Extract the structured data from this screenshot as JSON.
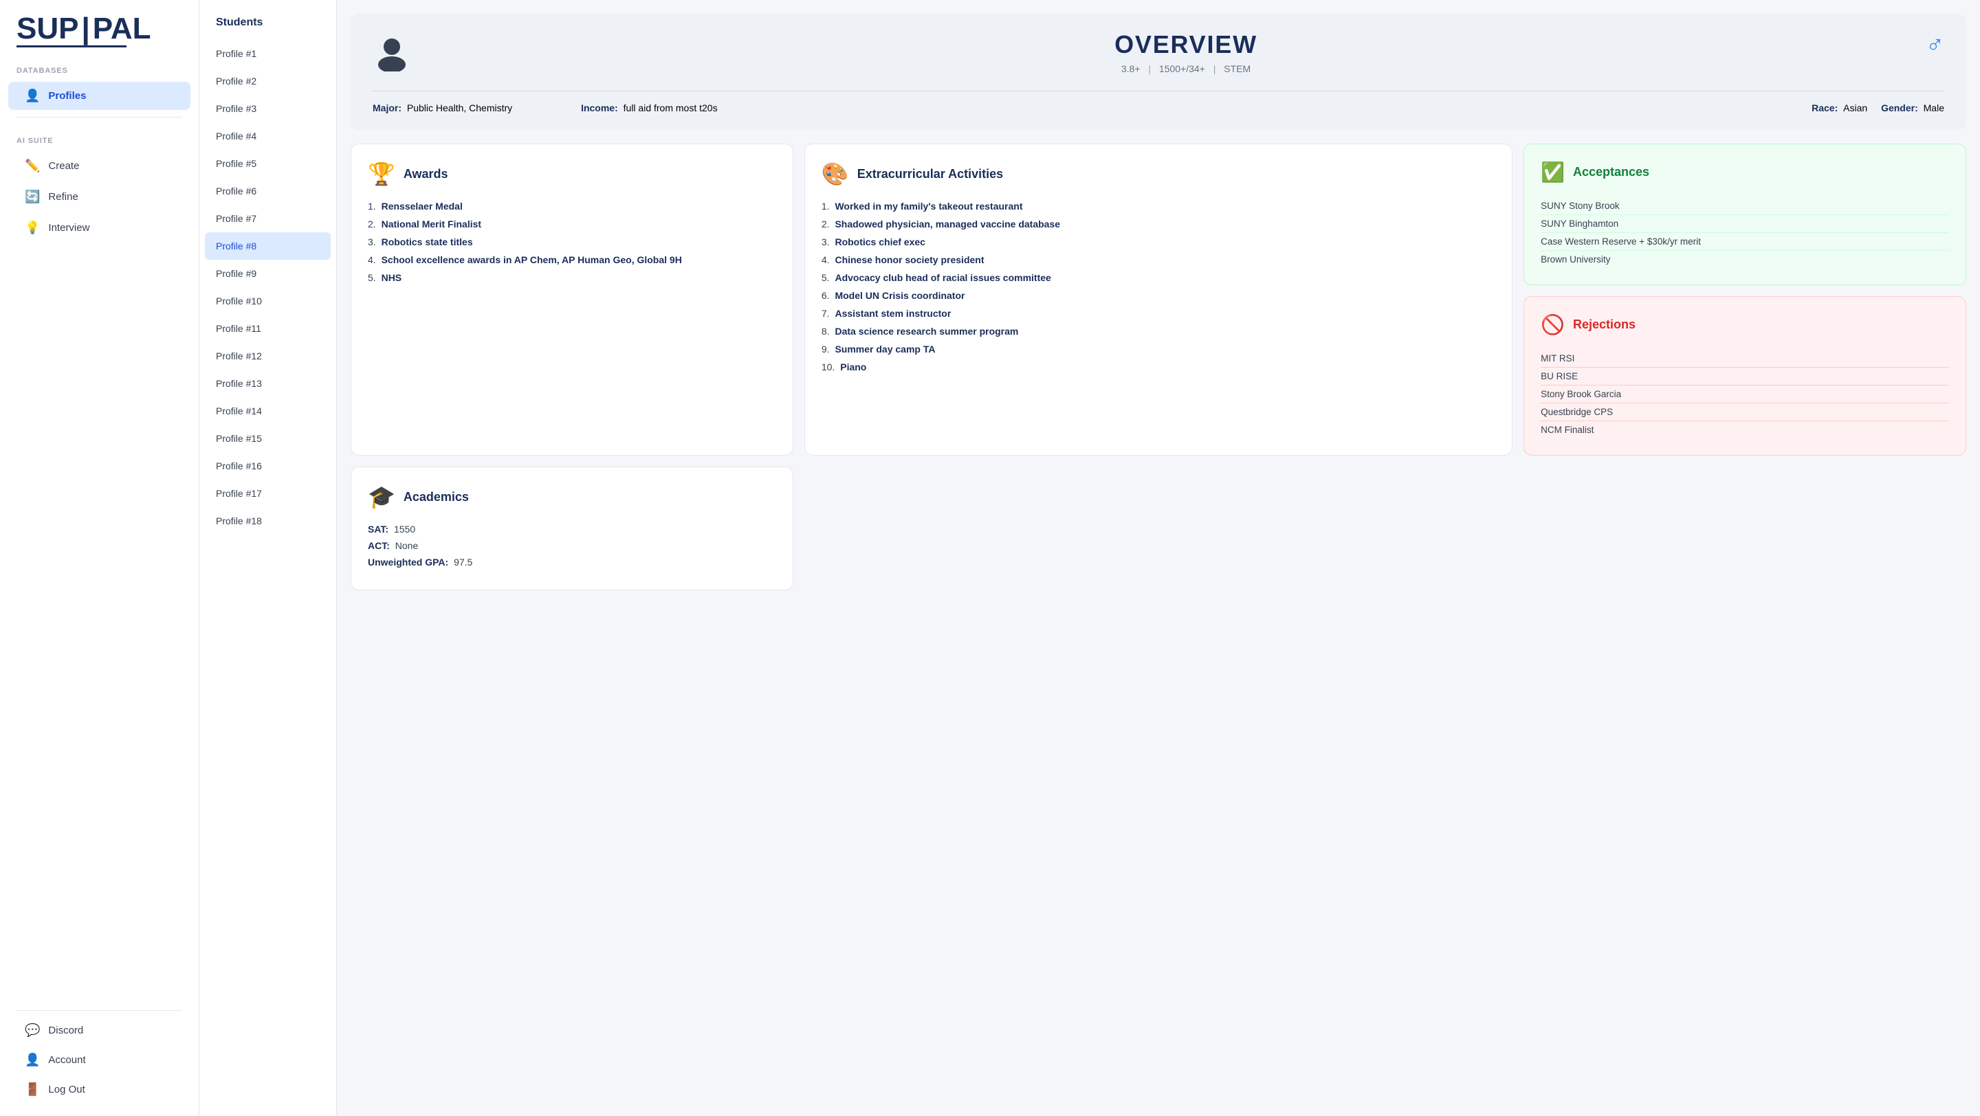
{
  "sidebar": {
    "logo_top": "SUP",
    "logo_bottom": "PAL",
    "databases_label": "DATABASES",
    "profiles_label": "Profiles",
    "ai_suite_label": "AI SUITE",
    "create_label": "Create",
    "refine_label": "Refine",
    "interview_label": "Interview",
    "discord_label": "Discord",
    "account_label": "Account",
    "logout_label": "Log Out"
  },
  "profile_list": {
    "header": "Students",
    "items": [
      "Profile #1",
      "Profile #2",
      "Profile #3",
      "Profile #4",
      "Profile #5",
      "Profile #6",
      "Profile #7",
      "Profile #8",
      "Profile #9",
      "Profile #10",
      "Profile #11",
      "Profile #12",
      "Profile #13",
      "Profile #14",
      "Profile #15",
      "Profile #16",
      "Profile #17",
      "Profile #18"
    ],
    "active_index": 7
  },
  "overview": {
    "title": "OVERVIEW",
    "gpa": "3.8+",
    "sat_range": "1500+/34+",
    "category": "STEM",
    "major_label": "Major:",
    "major_value": "Public Health, Chemistry",
    "income_label": "Income:",
    "income_value": "full aid from most t20s",
    "race_label": "Race:",
    "race_value": "Asian",
    "gender_label": "Gender:",
    "gender_value": "Male"
  },
  "awards": {
    "title": "Awards",
    "items": [
      "Rensselaer Medal",
      "National Merit Finalist",
      "Robotics state titles",
      "School excellence awards in AP Chem, AP Human Geo, Global 9H",
      "NHS"
    ]
  },
  "extracurriculars": {
    "title": "Extracurricular Activities",
    "items": [
      "Worked in my family's takeout restaurant",
      "Shadowed physician, managed vaccine database",
      "Robotics chief exec",
      "Chinese honor society president",
      "Advocacy club head of racial issues committee",
      "Model UN Crisis coordinator",
      "Assistant stem instructor",
      "Data science research summer program",
      "Summer day camp TA",
      "Piano"
    ]
  },
  "academics": {
    "title": "Academics",
    "sat_label": "SAT:",
    "sat_value": "1550",
    "act_label": "ACT:",
    "act_value": "None",
    "gpa_label": "Unweighted GPA:",
    "gpa_value": "97.5"
  },
  "acceptances": {
    "title": "Acceptances",
    "items": [
      "SUNY Stony Brook",
      "SUNY Binghamton",
      "Case Western Reserve + $30k/yr merit",
      "Brown University"
    ]
  },
  "rejections": {
    "title": "Rejections",
    "items": [
      "MIT RSI",
      "BU RISE",
      "Stony Brook Garcia",
      "Questbridge CPS",
      "NCM Finalist"
    ]
  }
}
